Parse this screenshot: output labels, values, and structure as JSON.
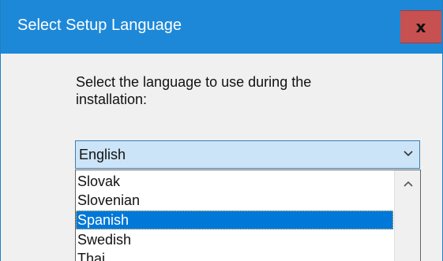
{
  "window": {
    "title": "Select Setup Language",
    "close_label": "x"
  },
  "prompt": {
    "text": "Select the language to use during the installation:"
  },
  "combo": {
    "selected_value": "English",
    "arrow_icon": "chevron-down-icon"
  },
  "language_list": {
    "items": [
      {
        "label": "Slovak",
        "selected": false
      },
      {
        "label": "Slovenian",
        "selected": false
      },
      {
        "label": "Spanish",
        "selected": true
      },
      {
        "label": "Swedish",
        "selected": false
      },
      {
        "label": "Thai",
        "selected": false
      }
    ],
    "scroll_up_icon": "chevron-up-icon"
  },
  "colors": {
    "titlebar": "#1e88d8",
    "close_button": "#c75050",
    "combo_background": "#cce4f7",
    "selection": "#0078d7"
  }
}
